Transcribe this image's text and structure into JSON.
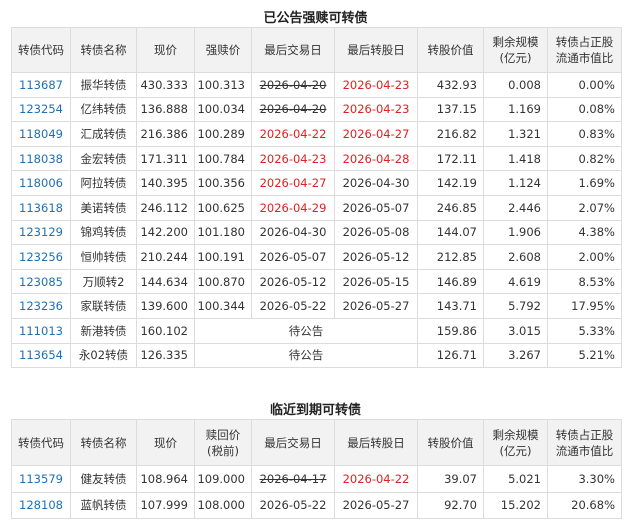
{
  "section1": {
    "title": "已公告强赎可转债",
    "headers": [
      "转债代码",
      "转债名称",
      "现价",
      "强赎价",
      "最后交易日",
      "最后转股日",
      "转股价值",
      "剩余规模\n(亿元)",
      "转债占正股\n流通市值比"
    ],
    "pending_label": "待公告",
    "rows": [
      {
        "code": "113687",
        "name": "振华转债",
        "price": "430.333",
        "redeem": "100.313",
        "last_trade": "2026-04-20",
        "last_trade_strike": true,
        "last_trade_red": false,
        "last_convert": "2026-04-23",
        "last_convert_red": true,
        "conv_value": "432.93",
        "scale": "0.008",
        "ratio": "0.00%"
      },
      {
        "code": "123254",
        "name": "亿纬转债",
        "price": "136.888",
        "redeem": "100.034",
        "last_trade": "2026-04-20",
        "last_trade_strike": true,
        "last_trade_red": false,
        "last_convert": "2026-04-23",
        "last_convert_red": true,
        "conv_value": "137.15",
        "scale": "1.169",
        "ratio": "0.08%"
      },
      {
        "code": "118049",
        "name": "汇成转债",
        "price": "216.386",
        "redeem": "100.289",
        "last_trade": "2026-04-22",
        "last_trade_strike": false,
        "last_trade_red": true,
        "last_convert": "2026-04-27",
        "last_convert_red": true,
        "conv_value": "216.82",
        "scale": "1.321",
        "ratio": "0.83%"
      },
      {
        "code": "118038",
        "name": "金宏转债",
        "price": "171.311",
        "redeem": "100.784",
        "last_trade": "2026-04-23",
        "last_trade_strike": false,
        "last_trade_red": true,
        "last_convert": "2026-04-28",
        "last_convert_red": true,
        "conv_value": "172.11",
        "scale": "1.418",
        "ratio": "0.82%"
      },
      {
        "code": "118006",
        "name": "阿拉转债",
        "price": "140.395",
        "redeem": "100.356",
        "last_trade": "2026-04-27",
        "last_trade_strike": false,
        "last_trade_red": true,
        "last_convert": "2026-04-30",
        "last_convert_red": false,
        "conv_value": "142.19",
        "scale": "1.124",
        "ratio": "1.69%"
      },
      {
        "code": "113618",
        "name": "美诺转债",
        "price": "246.112",
        "redeem": "100.625",
        "last_trade": "2026-04-29",
        "last_trade_strike": false,
        "last_trade_red": true,
        "last_convert": "2026-05-07",
        "last_convert_red": false,
        "conv_value": "246.85",
        "scale": "2.446",
        "ratio": "2.07%"
      },
      {
        "code": "123129",
        "name": "锦鸡转债",
        "price": "142.200",
        "redeem": "101.180",
        "last_trade": "2026-04-30",
        "last_trade_strike": false,
        "last_trade_red": false,
        "last_convert": "2026-05-08",
        "last_convert_red": false,
        "conv_value": "144.07",
        "scale": "1.906",
        "ratio": "4.38%"
      },
      {
        "code": "123256",
        "name": "恒帅转债",
        "price": "210.244",
        "redeem": "100.191",
        "last_trade": "2026-05-07",
        "last_trade_strike": false,
        "last_trade_red": false,
        "last_convert": "2026-05-12",
        "last_convert_red": false,
        "conv_value": "212.85",
        "scale": "2.608",
        "ratio": "2.00%"
      },
      {
        "code": "123085",
        "name": "万顺转2",
        "price": "144.634",
        "redeem": "100.870",
        "last_trade": "2026-05-12",
        "last_trade_strike": false,
        "last_trade_red": false,
        "last_convert": "2026-05-15",
        "last_convert_red": false,
        "conv_value": "146.89",
        "scale": "4.619",
        "ratio": "8.53%"
      },
      {
        "code": "123236",
        "name": "家联转债",
        "price": "139.600",
        "redeem": "100.344",
        "last_trade": "2026-05-22",
        "last_trade_strike": false,
        "last_trade_red": false,
        "last_convert": "2026-05-27",
        "last_convert_red": false,
        "conv_value": "143.71",
        "scale": "5.792",
        "ratio": "17.95%"
      },
      {
        "code": "111013",
        "name": "新港转债",
        "price": "160.102",
        "pending": true,
        "conv_value": "159.86",
        "scale": "3.015",
        "ratio": "5.33%"
      },
      {
        "code": "113654",
        "name": "永02转债",
        "price": "126.335",
        "pending": true,
        "conv_value": "126.71",
        "scale": "3.267",
        "ratio": "5.21%"
      }
    ]
  },
  "section2": {
    "title": "临近到期可转债",
    "headers": [
      "转债代码",
      "转债名称",
      "现价",
      "赎回价\n(税前)",
      "最后交易日",
      "最后转股日",
      "转股价值",
      "剩余规模\n(亿元)",
      "转债占正股\n流通市值比"
    ],
    "rows": [
      {
        "code": "113579",
        "name": "健友转债",
        "price": "108.964",
        "redeem": "109.000",
        "last_trade": "2026-04-17",
        "last_trade_strike": true,
        "last_trade_red": false,
        "last_convert": "2026-04-22",
        "last_convert_red": true,
        "conv_value": "39.07",
        "scale": "5.021",
        "ratio": "3.30%"
      },
      {
        "code": "128108",
        "name": "蓝帆转债",
        "price": "107.999",
        "redeem": "108.000",
        "last_trade": "2026-05-22",
        "last_trade_strike": false,
        "last_trade_red": false,
        "last_convert": "2026-05-27",
        "last_convert_red": false,
        "conv_value": "92.70",
        "scale": "15.202",
        "ratio": "20.68%"
      }
    ]
  },
  "colors": {
    "link": "#1f6fb5",
    "highlight": "#e02020",
    "header_bg": "#f2f2f2",
    "border": "#dcdcdc"
  }
}
